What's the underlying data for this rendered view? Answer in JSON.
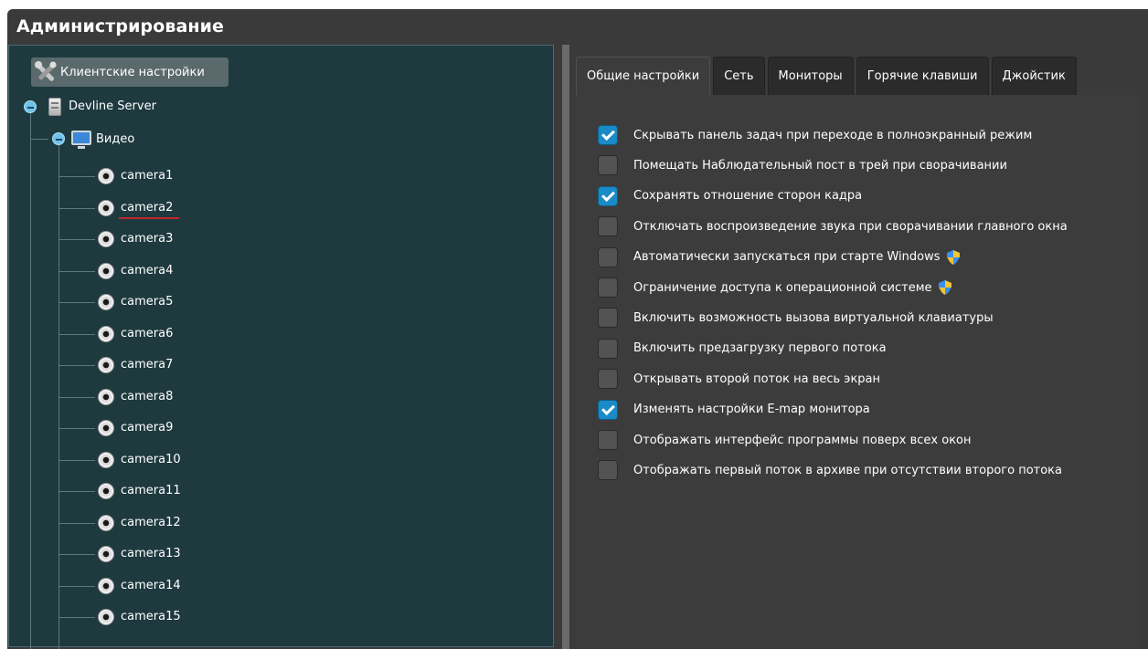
{
  "window": {
    "title": "Администрирование"
  },
  "tree": {
    "client_settings": "Клиентские настройки",
    "server": "Devline Server",
    "video": "Видео",
    "cameras": [
      "camera1",
      "camera2",
      "camera3",
      "camera4",
      "camera5",
      "camera6",
      "camera7",
      "camera8",
      "camera9",
      "camera10",
      "camera11",
      "camera12",
      "camera13",
      "camera14",
      "camera15"
    ]
  },
  "tabs": [
    {
      "label": "Общие настройки",
      "active": true
    },
    {
      "label": "Сеть",
      "active": false
    },
    {
      "label": "Мониторы",
      "active": false
    },
    {
      "label": "Горячие клавиши",
      "active": false
    },
    {
      "label": "Джойстик",
      "active": false
    }
  ],
  "options": [
    {
      "label": "Скрывать панель задач при переходе в полноэкранный режим",
      "checked": true,
      "shield": false
    },
    {
      "label": "Помещать Наблюдательный пост в трей при сворачивании",
      "checked": false,
      "shield": false
    },
    {
      "label": "Сохранять отношение сторон кадра",
      "checked": true,
      "shield": false
    },
    {
      "label": "Отключать воспроизведение звука при сворачивании главного окна",
      "checked": false,
      "shield": false
    },
    {
      "label": "Автоматически запускаться при старте Windows",
      "checked": false,
      "shield": true
    },
    {
      "label": "Ограничение доступа к операционной системе",
      "checked": false,
      "shield": true
    },
    {
      "label": "Включить возможность вызова виртуальной клавиатуры",
      "checked": false,
      "shield": false
    },
    {
      "label": "Включить предзагрузку первого потока",
      "checked": false,
      "shield": false
    },
    {
      "label": "Открывать второй поток на весь экран",
      "checked": false,
      "shield": false
    },
    {
      "label": "Изменять настройки E-map монитора",
      "checked": true,
      "shield": false
    },
    {
      "label": "Отображать интерфейс программы поверх всех окон",
      "checked": false,
      "shield": false
    },
    {
      "label": "Отображать первый поток в архиве при отсутствии второго потока",
      "checked": false,
      "shield": false
    }
  ],
  "icons": {
    "client_settings": "tools-icon",
    "server": "server-icon",
    "video": "monitor-icon",
    "camera": "camera-icon",
    "checkbox_on": "checkmark-icon",
    "uac": "uac-shield-icon"
  },
  "colors": {
    "tree_bg": "#1e3a3f",
    "panel_bg": "#3c3c3c",
    "checkbox_on": "#1a8bc6",
    "underline": "#c0272d"
  }
}
